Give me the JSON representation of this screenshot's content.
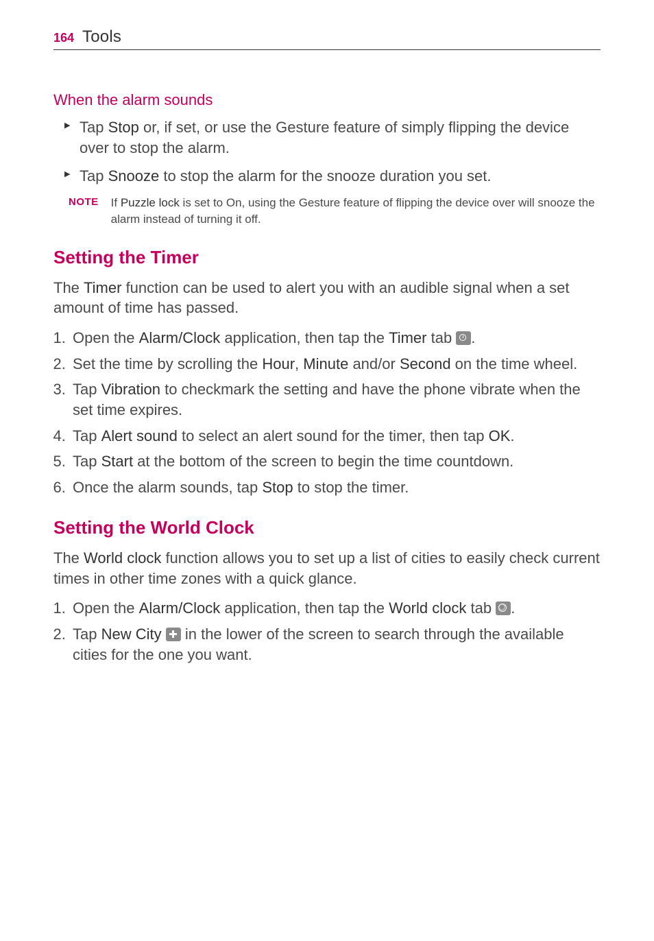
{
  "header": {
    "page_number": "164",
    "chapter": "Tools"
  },
  "section1": {
    "heading": "When the alarm sounds",
    "bullets": [
      {
        "pre": "Tap ",
        "bold": "Stop",
        "post": " or, if set, or use the Gesture feature of simply flipping the device over to stop the alarm."
      },
      {
        "pre": "Tap ",
        "bold": "Snooze",
        "post": " to stop the alarm for the snooze duration you set."
      }
    ],
    "note_label": "NOTE",
    "note_pre": "If ",
    "note_bold": "Puzzle lock",
    "note_post": " is set to On, using the Gesture feature of flipping the device over will snooze the alarm instead of turning it off."
  },
  "section2": {
    "heading": "Setting the Timer",
    "intro_pre": "The ",
    "intro_bold": "Timer",
    "intro_post": " function can be used to alert you with an audible signal when a set amount of time has passed.",
    "steps": {
      "s1_a": "Open the ",
      "s1_b": "Alarm/Clock",
      "s1_c": " application, then tap the ",
      "s1_d": "Timer",
      "s1_e": " tab ",
      "s1_f": ".",
      "s2_a": "Set the time by scrolling the ",
      "s2_b": "Hour",
      "s2_c": ", ",
      "s2_d": "Minute",
      "s2_e": " and/or ",
      "s2_f": "Second",
      "s2_g": " on the time wheel.",
      "s3_a": "Tap ",
      "s3_b": "Vibration",
      "s3_c": " to checkmark the setting and have the phone vibrate when the set time expires.",
      "s4_a": "Tap ",
      "s4_b": "Alert sound",
      "s4_c": " to select an alert sound for the timer, then tap ",
      "s4_d": "OK",
      "s4_e": ".",
      "s5_a": "Tap ",
      "s5_b": "Start",
      "s5_c": " at the bottom of the screen to begin the time countdown.",
      "s6_a": "Once the alarm sounds, tap ",
      "s6_b": "Stop",
      "s6_c": " to stop the timer."
    }
  },
  "section3": {
    "heading": "Setting the World Clock",
    "intro_pre": "The ",
    "intro_bold": "World clock",
    "intro_post": " function allows you to set up a list of cities to easily check current times in other time zones with a quick glance.",
    "steps": {
      "s1_a": "Open the ",
      "s1_b": "Alarm/Clock",
      "s1_c": " application, then tap the ",
      "s1_d": "World clock",
      "s1_e": " tab ",
      "s1_f": ".",
      "s2_a": "Tap ",
      "s2_b": "New City",
      "s2_c": " ",
      "s2_d": " in the lower of the screen to search through the available cities for the one you want."
    }
  }
}
